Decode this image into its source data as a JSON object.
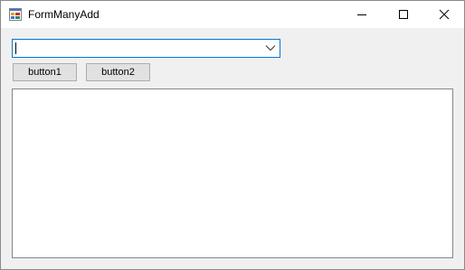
{
  "window": {
    "title": "FormManyAdd",
    "icon": "winforms-app-icon",
    "controls": {
      "minimize": "minimize-icon",
      "maximize": "maximize-icon",
      "close": "close-icon"
    }
  },
  "combobox": {
    "value": "",
    "arrow_icon": "chevron-down-icon",
    "focus_color": "#0078d7"
  },
  "buttons": {
    "button1": "button1",
    "button2": "button2"
  },
  "listbox": {
    "items": []
  }
}
